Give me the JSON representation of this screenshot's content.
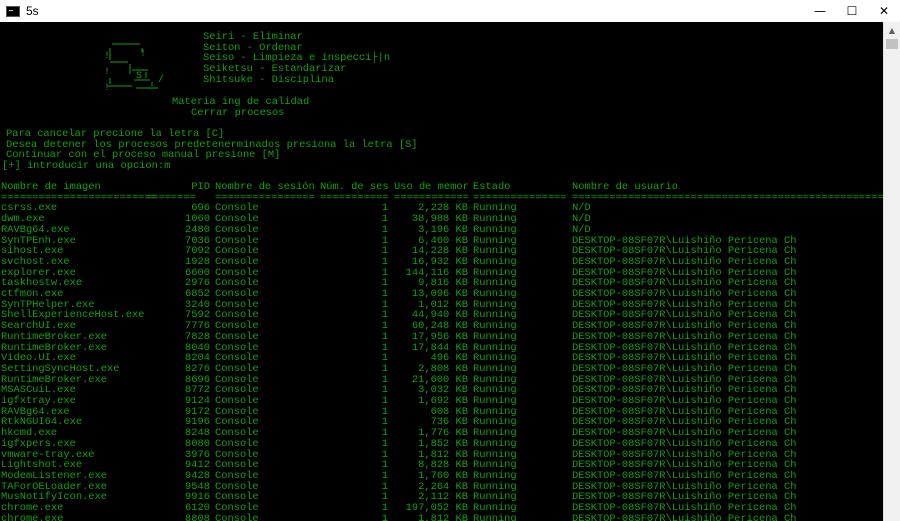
{
  "window": {
    "title": "5s",
    "minimize": "—",
    "maximize": "☐",
    "close": "✕"
  },
  "console": {
    "menu": [
      "Seiri - Eliminar",
      "Seiton - Ordenar",
      "Seiso - Limpieza e inspecci├|n",
      "Seiketsu - Estandarizar",
      "Shitsuke - Disciplina"
    ],
    "subtitle1": "Materia ing de calidad",
    "subtitle2": "Cerrar procesos",
    "instructions": [
      "Para cancelar precione la letra [C]",
      "Desea detener los procesos predetenerminados presiona la letra [S]",
      "Continuar con el proceso manual presione [M]",
      "[+] introducir una opcion:m"
    ],
    "table": {
      "headers": {
        "image": "Nombre de imagen",
        "pid": "PID",
        "session": "Nombre de sesión",
        "num": "Núm. de ses",
        "mem": "Uso de memor",
        "state": "Estado",
        "user": "Nombre de usuario"
      },
      "separators": {
        "image": "=========================",
        "pid": "========",
        "session": "================",
        "num": "===========",
        "mem": "============",
        "state": "===============",
        "user": "=================================================="
      },
      "rows": [
        {
          "image": "csrss.exe",
          "pid": "696",
          "session": "Console",
          "num": "1",
          "mem": "2,228 KB",
          "state": "Running",
          "user": "N/D"
        },
        {
          "image": "dwm.exe",
          "pid": "1060",
          "session": "Console",
          "num": "1",
          "mem": "38,988 KB",
          "state": "Running",
          "user": "N/D"
        },
        {
          "image": "RAVBg64.exe",
          "pid": "2480",
          "session": "Console",
          "num": "1",
          "mem": "3,196 KB",
          "state": "Running",
          "user": "N/D"
        },
        {
          "image": "SynTPEnh.exe",
          "pid": "7036",
          "session": "Console",
          "num": "1",
          "mem": "6,460 KB",
          "state": "Running",
          "user": "DESKTOP-08SF07R\\Luishiño Pericena Ch"
        },
        {
          "image": "sihost.exe",
          "pid": "7092",
          "session": "Console",
          "num": "1",
          "mem": "14,228 KB",
          "state": "Running",
          "user": "DESKTOP-08SF07R\\Luishiño Pericena Ch"
        },
        {
          "image": "svchost.exe",
          "pid": "1928",
          "session": "Console",
          "num": "1",
          "mem": "16,932 KB",
          "state": "Running",
          "user": "DESKTOP-08SF07R\\Luishiño Pericena Ch"
        },
        {
          "image": "explorer.exe",
          "pid": "6600",
          "session": "Console",
          "num": "1",
          "mem": "144,116 KB",
          "state": "Running",
          "user": "DESKTOP-08SF07R\\Luishiño Pericena Ch"
        },
        {
          "image": "taskhostw.exe",
          "pid": "2976",
          "session": "Console",
          "num": "1",
          "mem": "9,816 KB",
          "state": "Running",
          "user": "DESKTOP-08SF07R\\Luishiño Pericena Ch"
        },
        {
          "image": "ctfmon.exe",
          "pid": "6852",
          "session": "Console",
          "num": "1",
          "mem": "13,096 KB",
          "state": "Running",
          "user": "DESKTOP-08SF07R\\Luishiño Pericena Ch"
        },
        {
          "image": "SynTPHelper.exe",
          "pid": "3240",
          "session": "Console",
          "num": "1",
          "mem": "1,012 KB",
          "state": "Running",
          "user": "DESKTOP-08SF07R\\Luishiño Pericena Ch"
        },
        {
          "image": "ShellExperienceHost.exe",
          "pid": "7592",
          "session": "Console",
          "num": "1",
          "mem": "44,940 KB",
          "state": "Running",
          "user": "DESKTOP-08SF07R\\Luishiño Pericena Ch"
        },
        {
          "image": "SearchUI.exe",
          "pid": "7776",
          "session": "Console",
          "num": "1",
          "mem": "60,248 KB",
          "state": "Running",
          "user": "DESKTOP-08SF07R\\Luishiño Pericena Ch"
        },
        {
          "image": "RuntimeBroker.exe",
          "pid": "7828",
          "session": "Console",
          "num": "1",
          "mem": "17,956 KB",
          "state": "Running",
          "user": "DESKTOP-08SF07R\\Luishiño Pericena Ch"
        },
        {
          "image": "RuntimeBroker.exe",
          "pid": "8040",
          "session": "Console",
          "num": "1",
          "mem": "17,844 KB",
          "state": "Running",
          "user": "DESKTOP-08SF07R\\Luishiño Pericena Ch"
        },
        {
          "image": "Video.UI.exe",
          "pid": "8204",
          "session": "Console",
          "num": "1",
          "mem": "496 KB",
          "state": "Running",
          "user": "DESKTOP-08SF07R\\Luishiño Pericena Ch"
        },
        {
          "image": "SettingSyncHost.exe",
          "pid": "8276",
          "session": "Console",
          "num": "1",
          "mem": "2,808 KB",
          "state": "Running",
          "user": "DESKTOP-08SF07R\\Luishiño Pericena Ch"
        },
        {
          "image": "RuntimeBroker.exe",
          "pid": "8696",
          "session": "Console",
          "num": "1",
          "mem": "21,600 KB",
          "state": "Running",
          "user": "DESKTOP-08SF07R\\Luishiño Pericena Ch"
        },
        {
          "image": "MSASCuiL.exe",
          "pid": "8772",
          "session": "Console",
          "num": "1",
          "mem": "3,032 KB",
          "state": "Running",
          "user": "DESKTOP-08SF07R\\Luishiño Pericena Ch"
        },
        {
          "image": "igfxtray.exe",
          "pid": "9124",
          "session": "Console",
          "num": "1",
          "mem": "1,692 KB",
          "state": "Running",
          "user": "DESKTOP-08SF07R\\Luishiño Pericena Ch"
        },
        {
          "image": "RAVBg64.exe",
          "pid": "9172",
          "session": "Console",
          "num": "1",
          "mem": "608 KB",
          "state": "Running",
          "user": "DESKTOP-08SF07R\\Luishiño Pericena Ch"
        },
        {
          "image": "RtkNGUI64.exe",
          "pid": "9196",
          "session": "Console",
          "num": "1",
          "mem": "736 KB",
          "state": "Running",
          "user": "DESKTOP-08SF07R\\Luishiño Pericena Ch"
        },
        {
          "image": "hkcmd.exe",
          "pid": "8248",
          "session": "Console",
          "num": "1",
          "mem": "1,776 KB",
          "state": "Running",
          "user": "DESKTOP-08SF07R\\Luishiño Pericena Ch"
        },
        {
          "image": "igfxpers.exe",
          "pid": "8080",
          "session": "Console",
          "num": "1",
          "mem": "1,852 KB",
          "state": "Running",
          "user": "DESKTOP-08SF07R\\Luishiño Pericena Ch"
        },
        {
          "image": "vmware-tray.exe",
          "pid": "3976",
          "session": "Console",
          "num": "1",
          "mem": "1,812 KB",
          "state": "Running",
          "user": "DESKTOP-08SF07R\\Luishiño Pericena Ch"
        },
        {
          "image": "Lightshot.exe",
          "pid": "9412",
          "session": "Console",
          "num": "1",
          "mem": "8,828 KB",
          "state": "Running",
          "user": "DESKTOP-08SF07R\\Luishiño Pericena Ch"
        },
        {
          "image": "ModemListener.exe",
          "pid": "9428",
          "session": "Console",
          "num": "1",
          "mem": "1,760 KB",
          "state": "Running",
          "user": "DESKTOP-08SF07R\\Luishiño Pericena Ch"
        },
        {
          "image": "TAForOELoader.exe",
          "pid": "9548",
          "session": "Console",
          "num": "1",
          "mem": "2,264 KB",
          "state": "Running",
          "user": "DESKTOP-08SF07R\\Luishiño Pericena Ch"
        },
        {
          "image": "MusNotifyIcon.exe",
          "pid": "9916",
          "session": "Console",
          "num": "1",
          "mem": "2,112 KB",
          "state": "Running",
          "user": "DESKTOP-08SF07R\\Luishiño Pericena Ch"
        },
        {
          "image": "chrome.exe",
          "pid": "6120",
          "session": "Console",
          "num": "1",
          "mem": "197,052 KB",
          "state": "Running",
          "user": "DESKTOP-08SF07R\\Luishiño Pericena Ch"
        },
        {
          "image": "chrome.exe",
          "pid": "8808",
          "session": "Console",
          "num": "1",
          "mem": "1,812 KB",
          "state": "Running",
          "user": "DESKTOP-08SF07R\\Luishiño Pericena Ch"
        }
      ]
    }
  },
  "colors": {
    "console_bg": "#000000",
    "console_fg": "#13a10e",
    "titlebar_bg": "#ffffff",
    "scrollbar_bg": "#f0f0f0"
  },
  "icons": {
    "app": "console-app-icon",
    "scroll_up": "scroll-up-arrow-icon"
  }
}
